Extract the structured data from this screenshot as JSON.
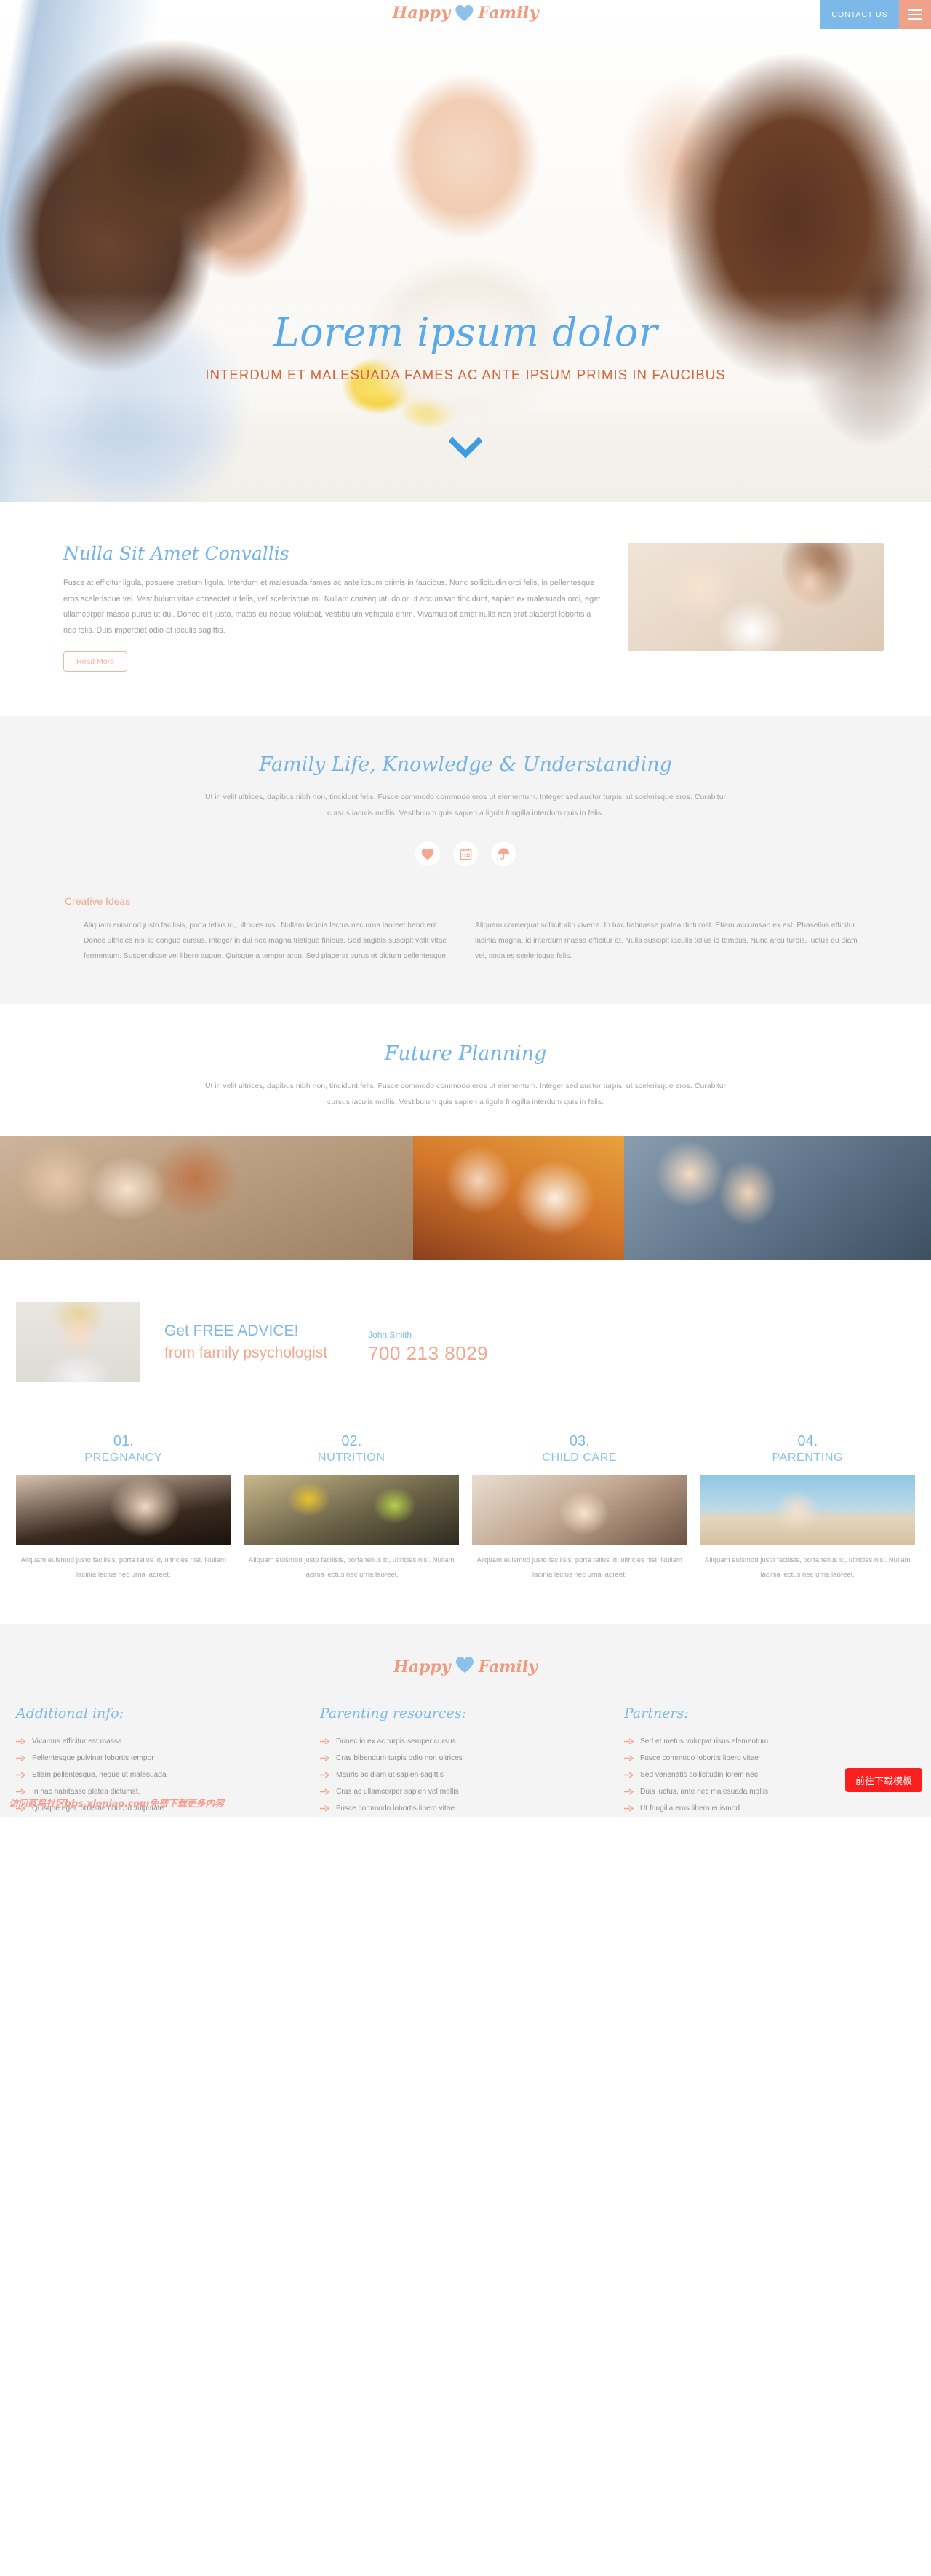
{
  "header": {
    "logo_first": "Happy",
    "logo_second": "Family",
    "logo_heart_icon": "heart-icon",
    "contact_label": "CONTACT US",
    "menu_icon": "hamburger-menu-icon"
  },
  "hero": {
    "title": "Lorem ipsum dolor",
    "subtitle": "INTERDUM ET MALESUADA FAMES AC ANTE IPSUM PRIMIS IN FAUCIBUS",
    "arrow_icon": "chevron-down-icon"
  },
  "intro": {
    "heading": "Nulla Sit Amet Convallis",
    "body": "Fusce at efficitur ligula, posuere pretium ligula. Interdum et malesuada fames ac ante ipsum primis in faucibus. Nunc sollicitudin orci felis, in pellentesque eros scelerisque vel. Vestibulum vitae consectetur felis, vel scelerisque mi. Nullam consequat, dolor ut accumsan tincidunt, sapien ex malesuada orci, eget ullamcorper massa purus ut dui. Donec elit justo, mattis eu neque volutpat, vestibulum vehicula enim. Vivamus sit amet nulla non erat placerat lobortis a nec felis. Duis imperdiet odio at iaculis sagittis.",
    "button_label": "Read More"
  },
  "family_life": {
    "heading": "Family Life, Knowledge & Understanding",
    "lead": "Ut in velit ultrices, dapibus nibh non, tincidunt felis. Fusce commodo commodo eros ut elementum. Integer sed auctor turpis, ut scelerisque eros. Curabitur cursus iaculis mollis. Vestibulum quis sapien a ligula fringilla interdum quis in felis.",
    "icons": [
      "heart-icon",
      "calendar-icon",
      "umbrella-icon"
    ],
    "col_left_heading": "Creative Ideas",
    "col_left_body": "Aliquam euismod justo facilisis, porta tellus id, ultricies nisi. Nullam lacinia lectus nec urna laoreet hendrerit. Donec ultricies nisi id congue cursus. Integer in dui nec magna tristique finibus. Sed sagittis suscipit velit vitae fermentum. Suspendisse vel libero augue. Quisque a tempor arcu. Sed placerat purus et dictum pellentesque.",
    "col_right_body": "Aliquam consequat sollicitudin viverra. In hac habitasse platea dictumst. Etiam accumsan ex est. Phasellus efficitur lacinia magna, id interdum massa efficitur at. Nulla suscipit iaculis tellus id tempus. Nunc arcu turpis, luctus eu diam vel, sodales scelerisque felis."
  },
  "future_planning": {
    "heading": "Future Planning",
    "lead": "Ut in velit ultrices, dapibus nibh non, tincidunt felis. Fusce commodo commodo eros ut elementum. Integer sed auctor turpis, ut scelerisque eros. Curabitur cursus iaculis mollis. Vestibulum quis sapien a ligula fringilla interdum quis in felis."
  },
  "advice": {
    "headline_blue": "Get FREE ADVICE!",
    "headline_orange": "from family psychologist",
    "contact_name": "John Smith",
    "contact_phone": "700 213 8029"
  },
  "categories": [
    {
      "num": "01.",
      "title": "PREGNANCY",
      "caption": "Aliquam euismod justo facilisis, porta tellus id, ultricies nisi. Nullam lacinia lectus nec urna laoreet."
    },
    {
      "num": "02.",
      "title": "NUTRITION",
      "caption": "Aliquam euismod justo facilisis, porta tellus id, ultricies nisi. Nullam lacinia lectus nec urna laoreet."
    },
    {
      "num": "03.",
      "title": "CHILD CARE",
      "caption": "Aliquam euismod justo facilisis, porta tellus id, ultricies nisi. Nullam lacinia lectus nec urna laoreet."
    },
    {
      "num": "04.",
      "title": "PARENTING",
      "caption": "Aliquam euismod justo facilisis, porta tellus id, ultricies nisi. Nullam lacinia lectus nec urna laoreet."
    }
  ],
  "footer": {
    "logo_first": "Happy",
    "logo_second": "Family",
    "columns": [
      {
        "heading": "Additional info:",
        "links": [
          "Vivamus efficitur est massa",
          "Pellentesque pulvinar lobortis tempor",
          "Etiam pellentesque, neque ut malesuada",
          "In hac habitasse platea dictumst.",
          "Quisque eget molestie nunc id vulputate"
        ]
      },
      {
        "heading": "Parenting resources:",
        "links": [
          "Donec in ex ac turpis semper cursus",
          "Cras bibendum turpis odio non ultrices",
          "Mauris ac diam ut sapien sagittis",
          "Cras ac ullamcorper sapien vel mollis",
          "Fusce commodo lobortis libero vitae"
        ]
      },
      {
        "heading": "Partners:",
        "links": [
          "Sed et metus volutpat risus elementum",
          "Fusce commodo lobortis libero vitae",
          "Sed venenatis sollicitudin lorem nec",
          "Duis luctus, ante nec malesuada mollis",
          "Ut fringilla eros libero euismod"
        ]
      }
    ],
    "watermark": "访问蓝鸟社区bbs.xleniao.com免费下载更多内容",
    "download_button": "前往下载模板"
  },
  "colors": {
    "blue": "#7db9e8",
    "orange": "#f0a98f",
    "salmon": "#f09b80",
    "grey_bg": "#f4f4f4",
    "red": "#fa1f1f"
  }
}
